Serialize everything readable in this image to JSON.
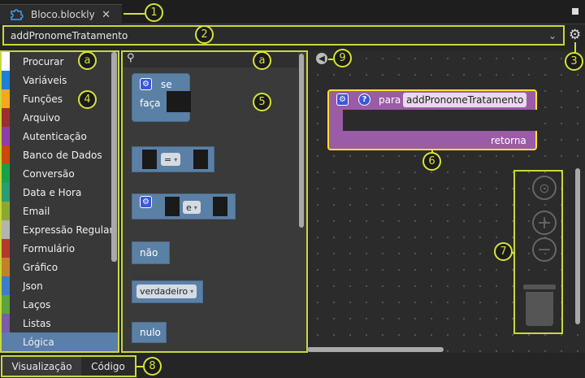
{
  "tab": {
    "title": "Bloco.blockly",
    "close": "✕",
    "icon": "puzzle-icon"
  },
  "selector": {
    "value": "addPronomeTratamento",
    "chevron": "⌄"
  },
  "categories": [
    {
      "label": "Procurar",
      "color": "#ffffff"
    },
    {
      "label": "Variáveis",
      "color": "#1e7fd6"
    },
    {
      "label": "Funções",
      "color": "#f5a623"
    },
    {
      "label": "Arquivo",
      "color": "#9b2f2f"
    },
    {
      "label": "Autenticação",
      "color": "#8e3fa6"
    },
    {
      "label": "Banco de Dados",
      "color": "#c94a0c"
    },
    {
      "label": "Conversão",
      "color": "#1aa04a"
    },
    {
      "label": "Data e Hora",
      "color": "#2b9c76"
    },
    {
      "label": "Email",
      "color": "#8da832"
    },
    {
      "label": "Expressão Regular",
      "color": "#b3b3b3"
    },
    {
      "label": "Formulário",
      "color": "#b03a2e"
    },
    {
      "label": "Gráfico",
      "color": "#c4812b"
    },
    {
      "label": "Json",
      "color": "#3d7cc9"
    },
    {
      "label": "Laços",
      "color": "#5ea33b"
    },
    {
      "label": "Listas",
      "color": "#7a5ca8"
    },
    {
      "label": "Lógica",
      "color": "#5a7fa8"
    }
  ],
  "flyout": {
    "if_label": "se",
    "do_label": "faça",
    "compare_op": "=",
    "logic_op": "e",
    "not_label": "não",
    "bool_value": "verdadeiro",
    "null_label": "nulo",
    "dropdown_arrow": "▾"
  },
  "procedure": {
    "for_label": "para",
    "name": "addPronomeTratamento",
    "return_label": "retorna"
  },
  "bottom_tabs": {
    "design": "Visualização",
    "code": "Código"
  },
  "callouts": [
    "1",
    "2",
    "3",
    "4",
    "5",
    "6",
    "7",
    "8",
    "9",
    "a",
    "a"
  ]
}
